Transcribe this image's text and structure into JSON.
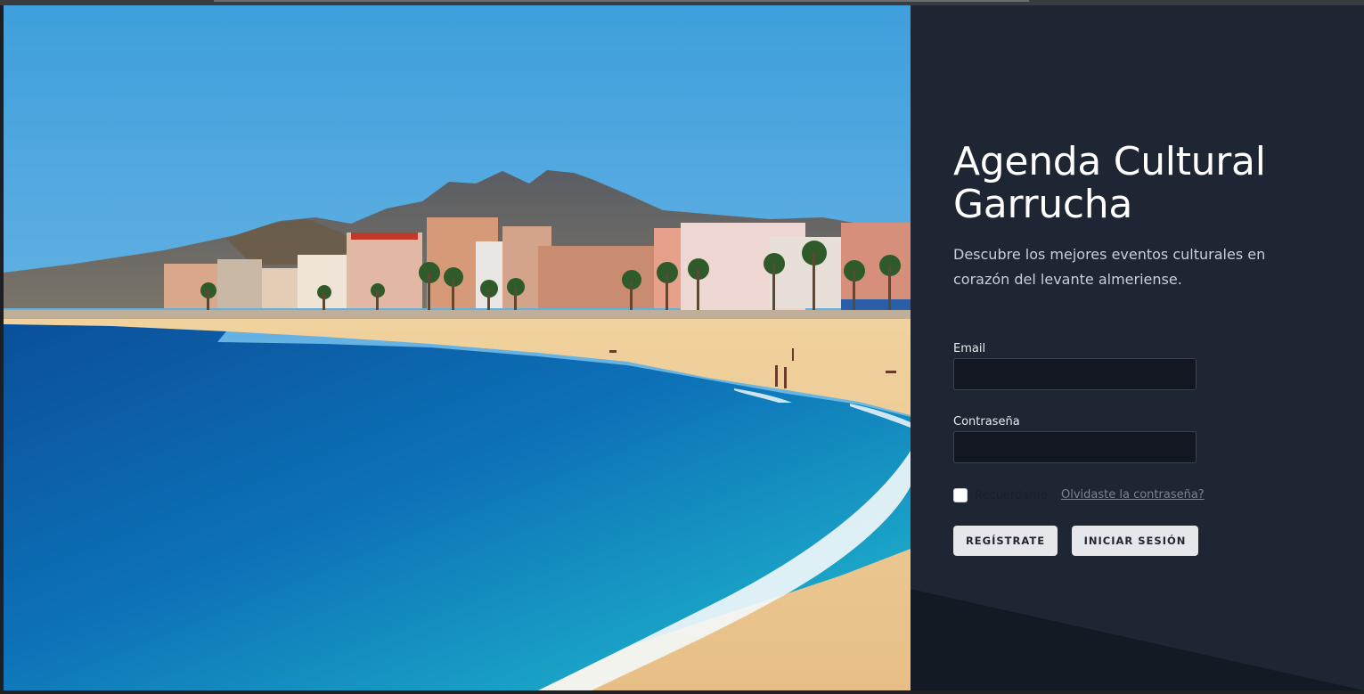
{
  "hero": {
    "image_description": "beach-photo"
  },
  "login": {
    "title_line1": "Agenda Cultural",
    "title_line2": "Garrucha",
    "subtitle": "Descubre los mejores eventos culturales en corazón del levante almeriense.",
    "email_label": "Email",
    "email_value": "",
    "password_label": "Contraseña",
    "password_value": "",
    "remember_label": "Recuérdame",
    "forgot_link": "Olvidaste la contraseña?",
    "register_button": "Regístrate",
    "login_button": "Iniciar sesión"
  },
  "colors": {
    "panel_bg": "#1f2633",
    "input_bg": "#121722",
    "button_bg": "#e5e7eb",
    "title": "#ffffff"
  }
}
